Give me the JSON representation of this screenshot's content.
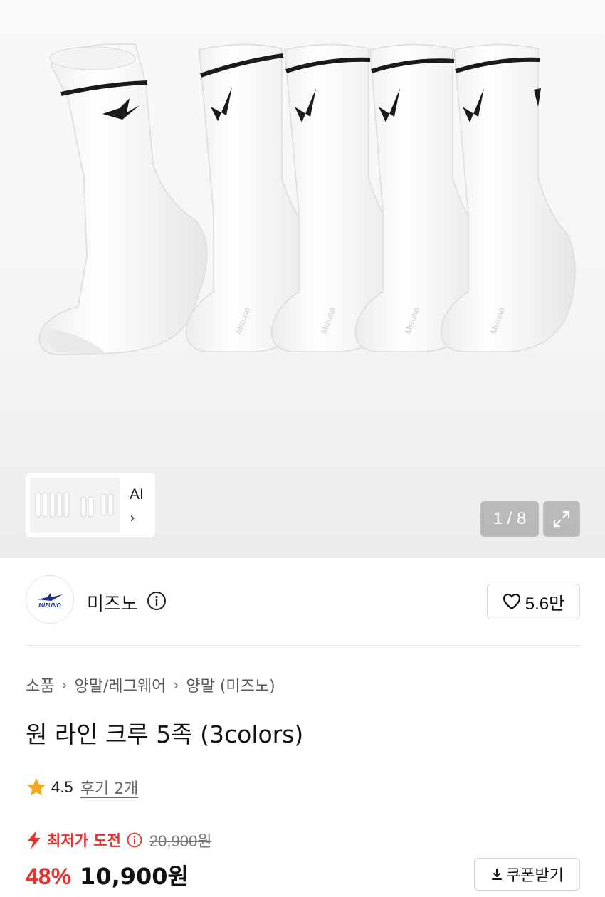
{
  "gallery": {
    "counter": "1 / 8",
    "thumb_label": "AI",
    "thumb_arrow": "›"
  },
  "brand": {
    "logo_text": "MIZUNO",
    "name": "미즈노",
    "like_count": "5.6만"
  },
  "breadcrumb": [
    "소품",
    "양말/레그웨어",
    "양말 (미즈노)"
  ],
  "breadcrumb_sep": "›",
  "product": {
    "title": "원 라인 크루 5족 (3colors)",
    "rating": "4.5",
    "review_link": "후기 2개"
  },
  "price": {
    "promo_label": "최저가 도전",
    "original_price": "20,900원",
    "discount": "48%",
    "sale_price": "10,900원",
    "coupon_label": "쿠폰받기"
  },
  "colors": {
    "accent_red": "#e8322c",
    "star": "#f5a623",
    "brand_blue": "#1c2f8c"
  }
}
